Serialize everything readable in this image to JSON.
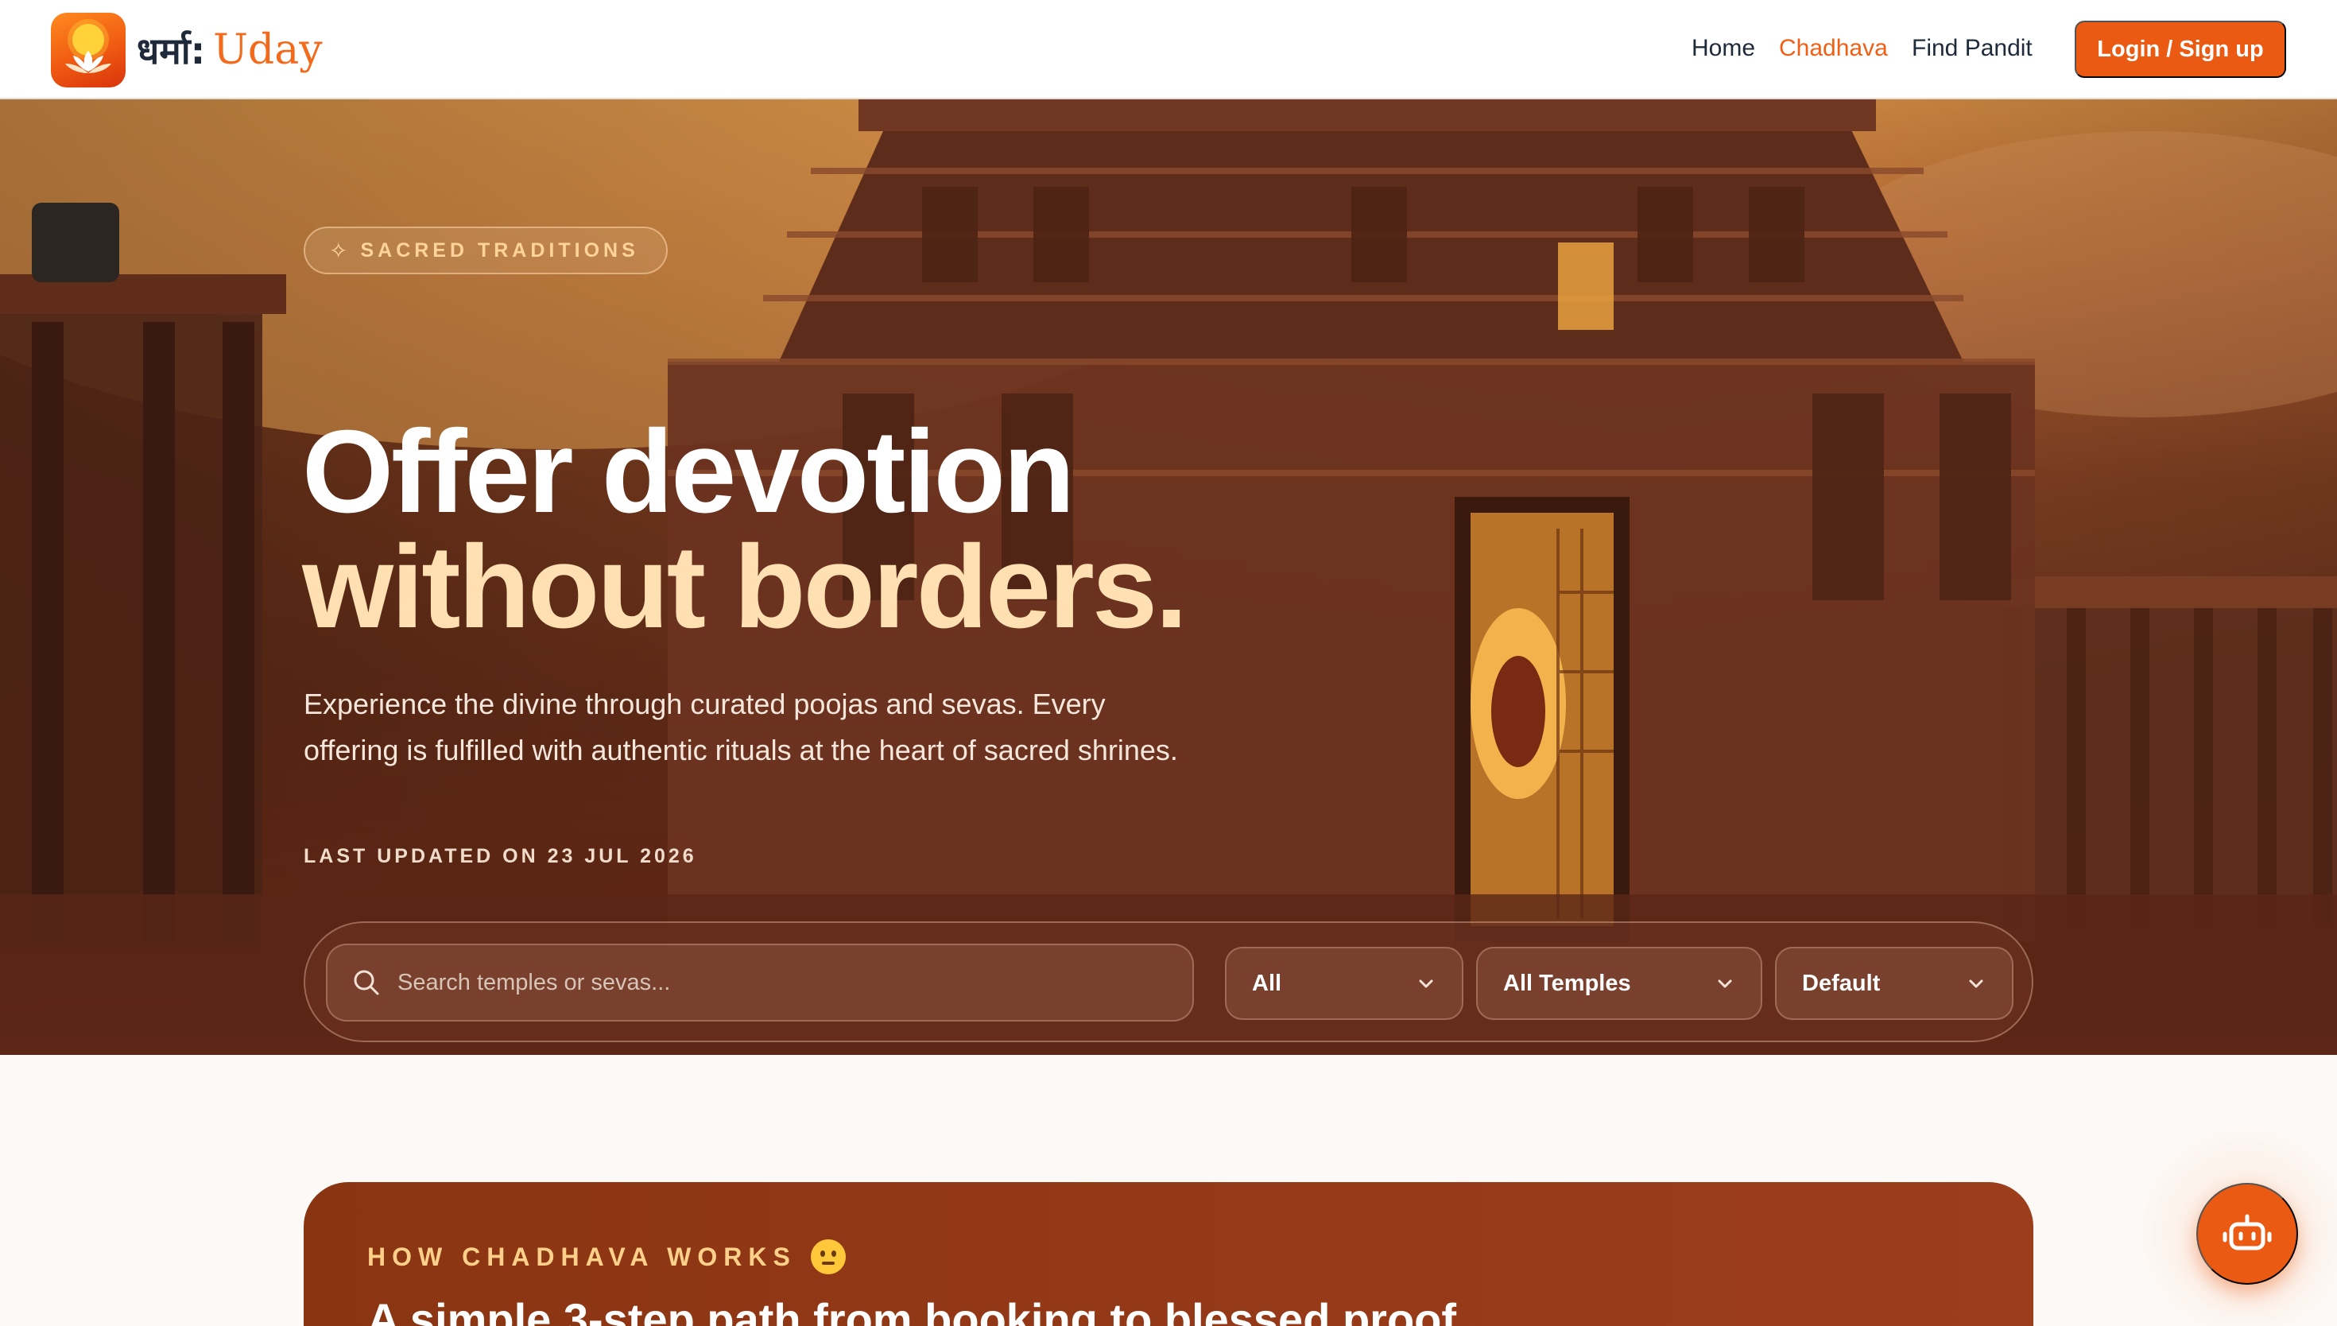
{
  "brand": {
    "name_hindi": "धर्मा:",
    "name_english": "Uday"
  },
  "nav": {
    "items": [
      {
        "label": "Home",
        "active": false
      },
      {
        "label": "Chadhava",
        "active": true
      },
      {
        "label": "Find Pandit",
        "active": false
      }
    ],
    "login_label": "Login / Sign up"
  },
  "hero": {
    "badge": "SACRED TRADITIONS",
    "title_line1": "Offer devotion",
    "title_line2": "without borders.",
    "subtitle": "Experience the divine through curated poojas and sevas. Every offering is fulfilled with authentic rituals at the heart of sacred shrines.",
    "last_updated": "LAST UPDATED ON 23 JUL 2026"
  },
  "filters": {
    "search_placeholder": "Search temples or sevas...",
    "search_value": "",
    "category": "All",
    "temple": "All Temples",
    "sort": "Default"
  },
  "how_it_works": {
    "label": "HOW CHADHAVA WORKS",
    "title": "A simple 3-step path from booking to blessed proof"
  },
  "colors": {
    "accent": "#ea5a12",
    "nav_active": "#ef5f14",
    "brand_dark": "#1e2a3a",
    "hero_highlight": "#ffe0b2",
    "card_bg": "#8a3512"
  },
  "icons": {
    "badge": "sparkle-icon",
    "search": "search-icon",
    "select": "chevron-down-icon",
    "chatbot": "robot-icon"
  }
}
